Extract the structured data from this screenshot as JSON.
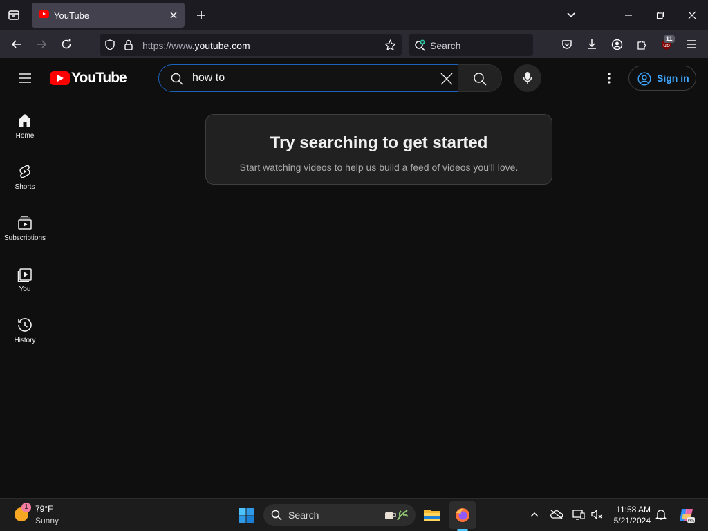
{
  "browser": {
    "tab_title": "YouTube",
    "url_prefix": "https://www.",
    "url_domain": "youtube.com",
    "search_placeholder": "Search",
    "extension_badge": "11"
  },
  "youtube": {
    "logo_text": "YouTube",
    "search_query": "how to",
    "sign_in_label": "Sign in",
    "guide": [
      {
        "label": "Home",
        "icon": "home-icon"
      },
      {
        "label": "Shorts",
        "icon": "shorts-icon"
      },
      {
        "label": "Subscriptions",
        "icon": "subscriptions-icon"
      },
      {
        "label": "You",
        "icon": "you-icon"
      },
      {
        "label": "History",
        "icon": "history-icon"
      }
    ],
    "prompt": {
      "heading": "Try searching to get started",
      "subtext": "Start watching videos to help us build a feed of videos you'll love."
    }
  },
  "taskbar": {
    "weather_temp": "79°F",
    "weather_condition": "Sunny",
    "weather_badge": "1",
    "search_placeholder": "Search",
    "time": "11:58 AM",
    "date": "5/21/2024"
  },
  "colors": {
    "background": "#0f0f0f",
    "brand_red": "#ff0000",
    "link_blue": "#3ea6ff",
    "search_focus": "#1c62b9"
  }
}
